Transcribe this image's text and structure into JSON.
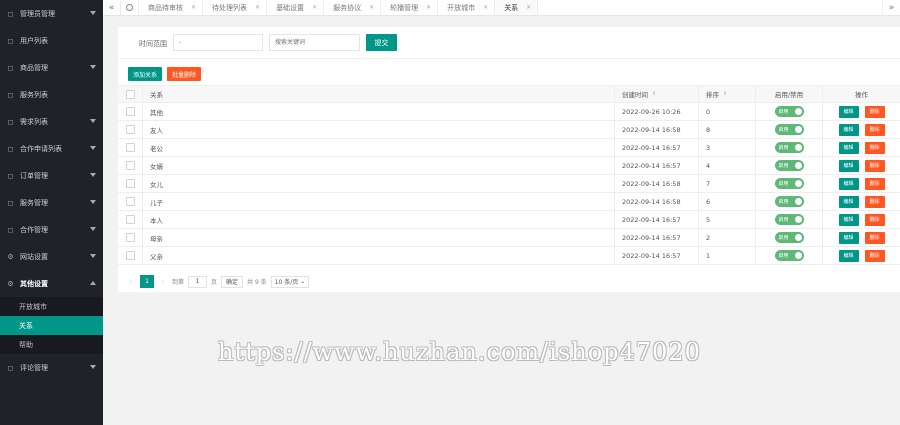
{
  "sidebar": {
    "items": [
      {
        "label": "管理员管理",
        "icon": "user-icon",
        "arrow": true
      },
      {
        "label": "用户列表",
        "icon": "users-icon",
        "arrow": false
      },
      {
        "label": "商品管理",
        "icon": "box-icon",
        "arrow": true
      },
      {
        "label": "服务列表",
        "icon": "list-icon",
        "arrow": false
      },
      {
        "label": "需求列表",
        "icon": "doc-icon",
        "arrow": true
      },
      {
        "label": "合作申请列表",
        "icon": "handshake-icon",
        "arrow": true
      },
      {
        "label": "订单管理",
        "icon": "order-icon",
        "arrow": true
      },
      {
        "label": "服务管理",
        "icon": "service-icon",
        "arrow": true
      },
      {
        "label": "合作管理",
        "icon": "partner-icon",
        "arrow": true
      },
      {
        "label": "网站设置",
        "icon": "gear-icon",
        "arrow": true
      },
      {
        "label": "其他设置",
        "icon": "gear-icon",
        "arrow": true
      }
    ],
    "submenu": [
      {
        "label": "开放城市",
        "active": false
      },
      {
        "label": "关系",
        "active": true
      },
      {
        "label": "帮助",
        "active": false
      }
    ],
    "last_item": {
      "label": "评论管理",
      "icon": "comment-icon"
    }
  },
  "tabs": [
    {
      "label": "商品待审核",
      "active": false
    },
    {
      "label": "待处理列表",
      "active": false
    },
    {
      "label": "基础设置",
      "active": false
    },
    {
      "label": "服务协议",
      "active": false
    },
    {
      "label": "轮播管理",
      "active": false
    },
    {
      "label": "开放城市",
      "active": false
    },
    {
      "label": "关系",
      "active": true
    }
  ],
  "filter": {
    "label": "时间范围",
    "date_placeholder": "-",
    "keyword_placeholder": "搜索关键词",
    "submit_label": "提交"
  },
  "toolbar": {
    "add_label": "添加关系",
    "batch_delete_label": "批量删除"
  },
  "table": {
    "headers": {
      "name": "关系",
      "time": "创建时间",
      "sort": "排序",
      "status": "启用/禁用",
      "ops": "操作"
    },
    "rows": [
      {
        "name": "其他",
        "time": "2022-09-26 10:26",
        "sort": "0"
      },
      {
        "name": "友人",
        "time": "2022-09-14 16:58",
        "sort": "8"
      },
      {
        "name": "老公",
        "time": "2022-09-14 16:57",
        "sort": "3"
      },
      {
        "name": "女婿",
        "time": "2022-09-14 16:57",
        "sort": "4"
      },
      {
        "name": "女儿",
        "time": "2022-09-14 16:58",
        "sort": "7"
      },
      {
        "name": "儿子",
        "time": "2022-09-14 16:58",
        "sort": "6"
      },
      {
        "name": "本人",
        "time": "2022-09-14 16:57",
        "sort": "5"
      },
      {
        "name": "母亲",
        "time": "2022-09-14 16:57",
        "sort": "2"
      },
      {
        "name": "父亲",
        "time": "2022-09-14 16:57",
        "sort": "1"
      }
    ],
    "switch_label": "启用",
    "edit_label": "编辑",
    "delete_label": "删除"
  },
  "pager": {
    "current": "1",
    "goto_prefix": "到第",
    "goto_value": "1",
    "goto_suffix": "页",
    "confirm_label": "确定",
    "total": "共 9 条",
    "page_size": "10 条/页"
  },
  "watermark": "https://www.huzhan.com/ishop47020",
  "colors": {
    "primary": "#009688",
    "danger": "#ff5722",
    "switch_on": "#5fb878",
    "sidebar_bg": "#20222a"
  }
}
